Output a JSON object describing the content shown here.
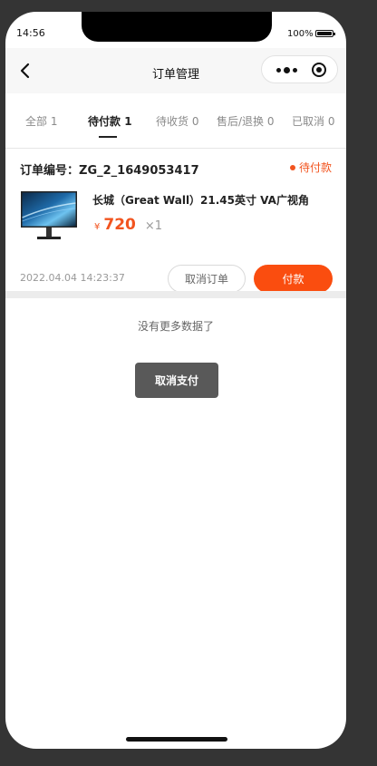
{
  "status_bar": {
    "time": "14:56",
    "battery": "100%"
  },
  "navbar": {
    "title": "订单管理",
    "back_icon": "chevron-left-icon",
    "more_icon": "more-dots-icon",
    "close_icon": "target-circle-icon"
  },
  "tabs": [
    {
      "label": "全部",
      "count": "1",
      "active": false
    },
    {
      "label": "待付款",
      "count": "1",
      "active": true
    },
    {
      "label": "待收货",
      "count": "0",
      "active": false
    },
    {
      "label": "售后/退换",
      "count": "0",
      "active": false
    },
    {
      "label": "已取消",
      "count": "0",
      "active": false
    }
  ],
  "order": {
    "number_label": "订单编号：",
    "number": "ZG_2_1649053417",
    "status": "待付款",
    "product_name": "长城（Great Wall）21.45英寸 VA广视角",
    "currency": "¥",
    "price": "720",
    "quantity": "×1",
    "time": "2022.04.04 14:23:37",
    "cancel_label": "取消订单",
    "pay_label": "付款"
  },
  "list_footer": "没有更多数据了",
  "toast": "取消支付",
  "colors": {
    "accent": "#fa4d0f",
    "status": "#f2541f",
    "toast_bg": "#595959"
  }
}
